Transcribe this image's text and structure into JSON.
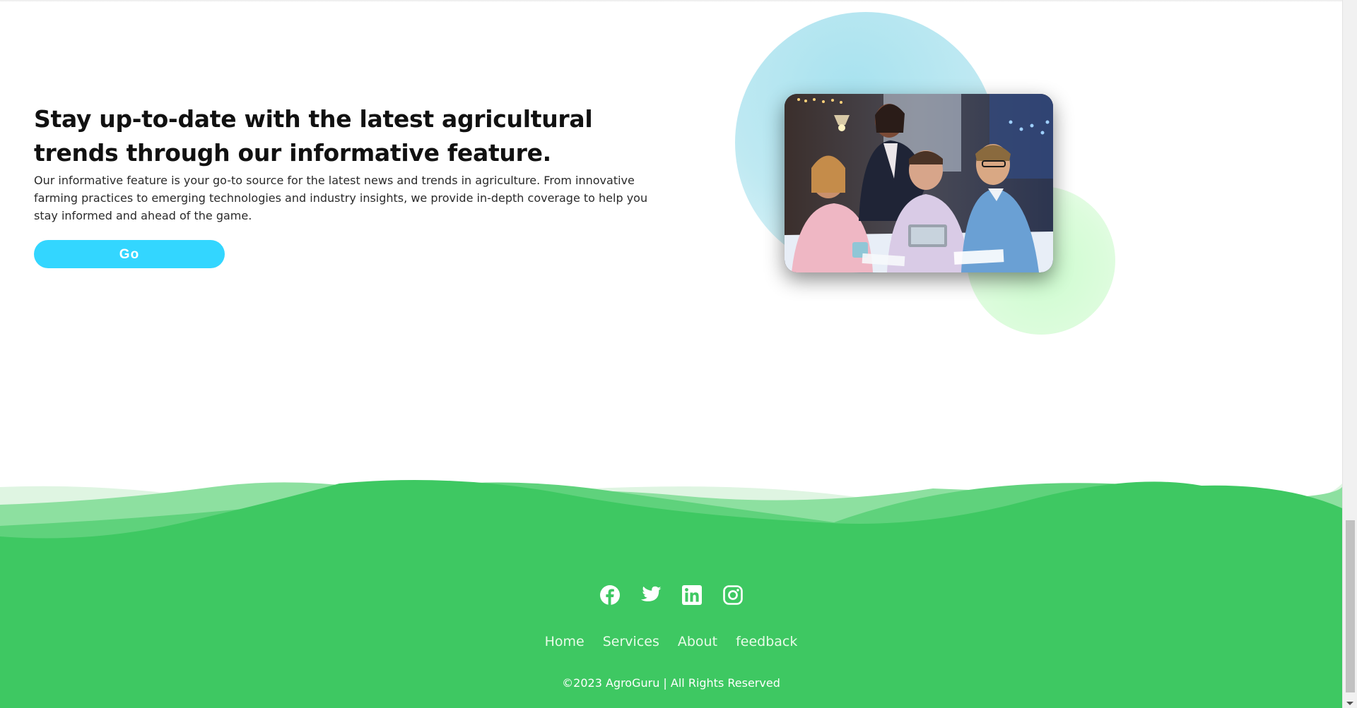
{
  "feature": {
    "title": "Stay up-to-date with the latest agricultural trends through our informative feature.",
    "description": "Our informative feature is your go-to source for the latest news and trends in agriculture. From innovative farming practices to emerging technologies and industry insights, we provide in-depth coverage to help you stay informed and ahead of the game.",
    "button_label": "Go",
    "image_icon": "team-meeting-photo"
  },
  "footer": {
    "social": [
      {
        "name": "facebook-icon"
      },
      {
        "name": "twitter-icon"
      },
      {
        "name": "linkedin-icon"
      },
      {
        "name": "instagram-icon"
      }
    ],
    "nav": [
      "Home",
      "Services",
      "About",
      "feedback"
    ],
    "copyright": "©2023 AgroGuru | All Rights Reserved"
  },
  "colors": {
    "accent": "#33d6ff",
    "footer_green": "#3ec862",
    "title_text": "#111111"
  }
}
